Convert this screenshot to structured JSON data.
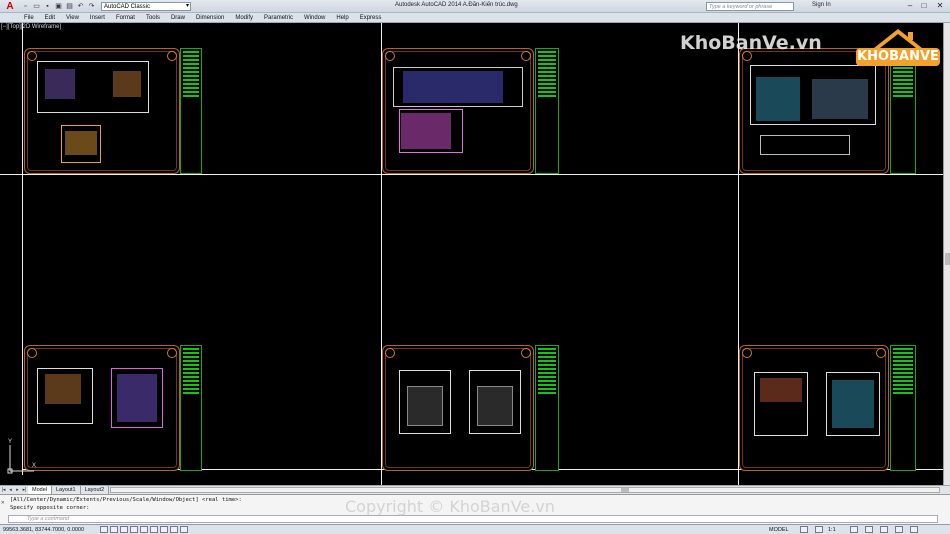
{
  "titlebar": {
    "app_icon": "autocad-a-icon",
    "workspace": "AutoCAD Classic",
    "window_title": "Autodesk AutoCAD 2014    A.Đăn-Kiến trúc.dwg",
    "search_placeholder": "Type a keyword or phrase",
    "sign_in": "Sign In"
  },
  "menu": [
    "File",
    "Edit",
    "View",
    "Insert",
    "Format",
    "Tools",
    "Draw",
    "Dimension",
    "Modify",
    "Parametric",
    "Window",
    "Help",
    "Express"
  ],
  "viewport": {
    "label": "[−][Top][2D Wireframe]"
  },
  "layout_tabs": [
    "Model",
    "Layout1",
    "Layout2"
  ],
  "command": {
    "history_1": "[All/Center/Dynamic/Extents/Previous/Scale/Window/Object] <real time>:",
    "history_2": "Specify opposite corner:",
    "input_placeholder": "Type a command"
  },
  "status": {
    "coordinates": "99563.3681, 83744.7000, 0.0000",
    "model": "MODEL",
    "scale": "1:1"
  },
  "watermark": {
    "site": "KhoBanVe.vn",
    "logo": "KHOBANVE",
    "copyright": "Copyright © KhoBanVe.vn"
  },
  "colors": {
    "sheet_border": "#b5651d",
    "title_block": "#1aa61a",
    "background": "#000000"
  }
}
